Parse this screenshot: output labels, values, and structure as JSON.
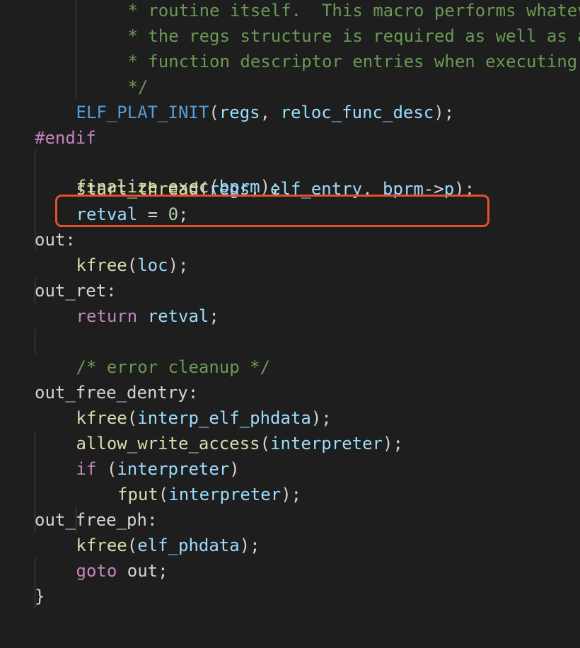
{
  "colors": {
    "background": "#1e1e1e",
    "plain": "#d4d4d4",
    "comment": "#6a9955",
    "macro": "#569cd6",
    "preprocessor": "#c586c0",
    "keyword": "#c586c0",
    "function": "#dcdcaa",
    "variable": "#9cdcfe",
    "number": "#b5cea8",
    "highlight_border": "#e3512b"
  },
  "highlighted_line_index": 7,
  "code": {
    "lines": [
      {
        "indent": 2,
        "tokens": [
          {
            "t": " * routine itself.  This macro performs whatever i",
            "c": "comment"
          }
        ]
      },
      {
        "indent": 2,
        "tokens": [
          {
            "t": " * the regs structure is required as well as any r",
            "c": "comment"
          }
        ]
      },
      {
        "indent": 2,
        "tokens": [
          {
            "t": " * function descriptor entries when executing dyna",
            "c": "comment"
          }
        ]
      },
      {
        "indent": 2,
        "tokens": [
          {
            "t": " */",
            "c": "comment"
          }
        ]
      },
      {
        "indent": 1,
        "tokens": [
          {
            "t": "ELF_PLAT_INIT",
            "c": "macro"
          },
          {
            "t": "(",
            "c": "plain"
          },
          {
            "t": "regs",
            "c": "variable"
          },
          {
            "t": ", ",
            "c": "plain"
          },
          {
            "t": "reloc_func_desc",
            "c": "variable"
          },
          {
            "t": ");",
            "c": "plain"
          }
        ]
      },
      {
        "indent": 0,
        "tokens": [
          {
            "t": "#endif",
            "c": "preprocessor"
          }
        ]
      },
      {
        "indent": 0,
        "tokens": []
      },
      {
        "indent": 1,
        "tokens": [
          {
            "t": "start_thread",
            "c": "function"
          },
          {
            "t": "(",
            "c": "plain"
          },
          {
            "t": "regs",
            "c": "variable"
          },
          {
            "t": ", ",
            "c": "plain"
          },
          {
            "t": "elf_entry",
            "c": "variable"
          },
          {
            "t": ", ",
            "c": "plain"
          },
          {
            "t": "bprm",
            "c": "variable"
          },
          {
            "t": "->",
            "c": "plain"
          },
          {
            "t": "p",
            "c": "variable"
          },
          {
            "t": ");",
            "c": "plain"
          }
        ]
      },
      {
        "indent": 1,
        "tokens": [
          {
            "t": "retval",
            "c": "variable"
          },
          {
            "t": " = ",
            "c": "plain"
          },
          {
            "t": "0",
            "c": "number"
          },
          {
            "t": ";",
            "c": "plain"
          }
        ]
      },
      {
        "indent": 0,
        "tokens": [
          {
            "t": "out:",
            "c": "plain"
          }
        ]
      },
      {
        "indent": 1,
        "tokens": [
          {
            "t": "kfree",
            "c": "function"
          },
          {
            "t": "(",
            "c": "plain"
          },
          {
            "t": "loc",
            "c": "variable"
          },
          {
            "t": ");",
            "c": "plain"
          }
        ]
      },
      {
        "indent": 0,
        "tokens": [
          {
            "t": "out_ret:",
            "c": "plain"
          }
        ]
      },
      {
        "indent": 1,
        "tokens": [
          {
            "t": "return",
            "c": "keyword"
          },
          {
            "t": " ",
            "c": "plain"
          },
          {
            "t": "retval",
            "c": "variable"
          },
          {
            "t": ";",
            "c": "plain"
          }
        ]
      },
      {
        "indent": 0,
        "tokens": []
      },
      {
        "indent": 1,
        "tokens": [
          {
            "t": "/* error cleanup */",
            "c": "comment"
          }
        ]
      },
      {
        "indent": 0,
        "tokens": [
          {
            "t": "out_free_dentry:",
            "c": "plain"
          }
        ]
      },
      {
        "indent": 1,
        "tokens": [
          {
            "t": "kfree",
            "c": "function"
          },
          {
            "t": "(",
            "c": "plain"
          },
          {
            "t": "interp_elf_phdata",
            "c": "variable"
          },
          {
            "t": ");",
            "c": "plain"
          }
        ]
      },
      {
        "indent": 1,
        "tokens": [
          {
            "t": "allow_write_access",
            "c": "function"
          },
          {
            "t": "(",
            "c": "plain"
          },
          {
            "t": "interpreter",
            "c": "variable"
          },
          {
            "t": ");",
            "c": "plain"
          }
        ]
      },
      {
        "indent": 1,
        "tokens": [
          {
            "t": "if",
            "c": "keyword"
          },
          {
            "t": " (",
            "c": "plain"
          },
          {
            "t": "interpreter",
            "c": "variable"
          },
          {
            "t": ")",
            "c": "plain"
          }
        ]
      },
      {
        "indent": 2,
        "tokens": [
          {
            "t": "fput",
            "c": "function"
          },
          {
            "t": "(",
            "c": "plain"
          },
          {
            "t": "interpreter",
            "c": "variable"
          },
          {
            "t": ");",
            "c": "plain"
          }
        ]
      },
      {
        "indent": 0,
        "tokens": [
          {
            "t": "out_free_ph:",
            "c": "plain"
          }
        ]
      },
      {
        "indent": 1,
        "tokens": [
          {
            "t": "kfree",
            "c": "function"
          },
          {
            "t": "(",
            "c": "plain"
          },
          {
            "t": "elf_phdata",
            "c": "variable"
          },
          {
            "t": ");",
            "c": "plain"
          }
        ]
      },
      {
        "indent": 1,
        "tokens": [
          {
            "t": "goto",
            "c": "keyword"
          },
          {
            "t": " out;",
            "c": "plain"
          }
        ]
      },
      {
        "indent": 0,
        "tokens": [
          {
            "t": "}",
            "c": "plain"
          }
        ]
      }
    ],
    "partial_line": {
      "indent": 1,
      "tokens": [
        {
          "t": "finalize_exec",
          "c": "function"
        },
        {
          "t": "(",
          "c": "plain"
        },
        {
          "t": "bprm",
          "c": "variable"
        },
        {
          "t": ");",
          "c": "plain"
        }
      ]
    }
  }
}
